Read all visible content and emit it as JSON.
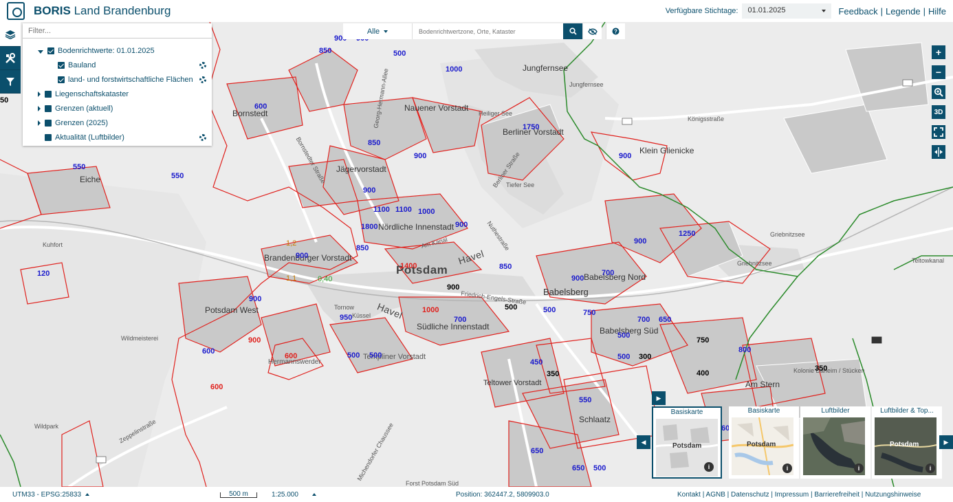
{
  "header": {
    "app_title_bold": "BORIS",
    "app_title_rest": "Land Brandenburg",
    "stichtag_label": "Verfügbare Stichtage:",
    "stichtag_value": "01.01.2025",
    "links": [
      "Feedback",
      "Legende",
      "Hilfe"
    ]
  },
  "layers": {
    "filter_placeholder": "Filter...",
    "items": [
      {
        "label": "Bodenrichtwerte: 01.01.2025"
      },
      {
        "label": "Bauland"
      },
      {
        "label": "land- und forstwirtschaftliche Flächen"
      },
      {
        "label": "Liegenschaftskataster"
      },
      {
        "label": "Grenzen (aktuell)"
      },
      {
        "label": "Grenzen (2025)"
      },
      {
        "label": "Aktualität (Luftbilder)"
      }
    ]
  },
  "search": {
    "filter_value": "Alle",
    "placeholder": "Bodenrichtwertzone, Orte, Kataster"
  },
  "map_controls": {
    "zoom_in": "+",
    "zoom_out": "−",
    "three_d": "3D"
  },
  "map_labels": [
    {
      "text": "Bornstedt"
    },
    {
      "text": "Eiche"
    },
    {
      "text": "Nauener Vorstadt"
    },
    {
      "text": "Jägervorstadt"
    },
    {
      "text": "Berliner Vorstadt"
    },
    {
      "text": "Jungfernsee"
    },
    {
      "text": "Jungfernsee"
    },
    {
      "text": "Klein Glienicke"
    },
    {
      "text": "Tiefer See"
    },
    {
      "text": "Heiliger See"
    },
    {
      "text": "Königsstraße"
    },
    {
      "text": "Griebnitzsee"
    },
    {
      "text": "Griebnitzsee"
    },
    {
      "text": "Brandenburger Vorstadt"
    },
    {
      "text": "Nördliche Innenstadt"
    },
    {
      "text": "Potsdam"
    },
    {
      "text": "Havel"
    },
    {
      "text": "Havel"
    },
    {
      "text": "Babelsberg Nord"
    },
    {
      "text": "Babelsberg"
    },
    {
      "text": "Babelsberg Süd"
    },
    {
      "text": "Potsdam West"
    },
    {
      "text": "Südliche Innenstadt"
    },
    {
      "text": "Templiner Vorstadt"
    },
    {
      "text": "Hermannswerder"
    },
    {
      "text": "Teltower Vorstadt"
    },
    {
      "text": "Schlaatz"
    },
    {
      "text": "Am Stern"
    },
    {
      "text": "Wildmeisterei"
    },
    {
      "text": "Wildpark"
    },
    {
      "text": "Kuhfort"
    },
    {
      "text": "Zeppelinstraße"
    },
    {
      "text": "Bornstedter Straße"
    },
    {
      "text": "Georg-Hermann-Allee"
    },
    {
      "text": "Berliner Straße"
    },
    {
      "text": "Nuthestraße"
    },
    {
      "text": "Friedrich-Engels-Straße"
    },
    {
      "text": "Am Kanal"
    },
    {
      "text": "Teltowkanal"
    },
    {
      "text": "Kolonie Daheim / Stücken"
    },
    {
      "text": "Tornow"
    },
    {
      "text": "Küssel"
    },
    {
      "text": "Michendorfer Chaussee"
    },
    {
      "text": "Forst Potsdam Süd"
    }
  ],
  "values": [
    {
      "text": "900",
      "color": "blue"
    },
    {
      "text": "900",
      "color": "blue"
    },
    {
      "text": "850",
      "color": "blue"
    },
    {
      "text": "500",
      "color": "blue"
    },
    {
      "text": "1000",
      "color": "blue"
    },
    {
      "text": "600",
      "color": "blue"
    },
    {
      "text": "850",
      "color": "blue"
    },
    {
      "text": "900",
      "color": "blue"
    },
    {
      "text": "1750",
      "color": "blue"
    },
    {
      "text": "900",
      "color": "blue"
    },
    {
      "text": "550",
      "color": "blue"
    },
    {
      "text": "550",
      "color": "blue"
    },
    {
      "text": "900",
      "color": "blue"
    },
    {
      "text": "1100",
      "color": "blue"
    },
    {
      "text": "1100",
      "color": "blue"
    },
    {
      "text": "1000",
      "color": "blue"
    },
    {
      "text": "1800",
      "color": "blue"
    },
    {
      "text": "900",
      "color": "blue"
    },
    {
      "text": "1250",
      "color": "blue"
    },
    {
      "text": "900",
      "color": "blue"
    },
    {
      "text": "850",
      "color": "blue"
    },
    {
      "text": "900",
      "color": "blue"
    },
    {
      "text": "1,2",
      "color": "orange"
    },
    {
      "text": "120",
      "color": "blue"
    },
    {
      "text": "1400",
      "color": "red"
    },
    {
      "text": "850",
      "color": "blue"
    },
    {
      "text": "900",
      "color": "blue"
    },
    {
      "text": "700",
      "color": "blue"
    },
    {
      "text": "1,1",
      "color": "orange"
    },
    {
      "text": "0,40",
      "color": "green"
    },
    {
      "text": "900",
      "color": "black"
    },
    {
      "text": "900",
      "color": "blue"
    },
    {
      "text": "500",
      "color": "black"
    },
    {
      "text": "500",
      "color": "blue"
    },
    {
      "text": "750",
      "color": "blue"
    },
    {
      "text": "1000",
      "color": "red"
    },
    {
      "text": "950",
      "color": "blue"
    },
    {
      "text": "700",
      "color": "blue"
    },
    {
      "text": "700",
      "color": "blue"
    },
    {
      "text": "650",
      "color": "blue"
    },
    {
      "text": "900",
      "color": "red"
    },
    {
      "text": "500",
      "color": "blue"
    },
    {
      "text": "750",
      "color": "black"
    },
    {
      "text": "600",
      "color": "blue"
    },
    {
      "text": "600",
      "color": "red"
    },
    {
      "text": "500",
      "color": "blue"
    },
    {
      "text": "500",
      "color": "blue"
    },
    {
      "text": "500",
      "color": "blue"
    },
    {
      "text": "300",
      "color": "black"
    },
    {
      "text": "800",
      "color": "blue"
    },
    {
      "text": "450",
      "color": "blue"
    },
    {
      "text": "350",
      "color": "black"
    },
    {
      "text": "400",
      "color": "black"
    },
    {
      "text": "350",
      "color": "black"
    },
    {
      "text": "600",
      "color": "red"
    },
    {
      "text": "550",
      "color": "blue"
    },
    {
      "text": "650",
      "color": "blue"
    },
    {
      "text": "650",
      "color": "blue"
    },
    {
      "text": "500",
      "color": "blue"
    },
    {
      "text": "60",
      "color": "blue"
    },
    {
      "text": "50",
      "color": "black"
    }
  ],
  "basemaps": [
    {
      "label": "Basiskarte",
      "active": true
    },
    {
      "label": "Basiskarte",
      "active": false
    },
    {
      "label": "Luftbilder",
      "active": false
    },
    {
      "label": "Luftbilder & Top...",
      "active": false
    }
  ],
  "basemap_thumb_label": "Potsdam",
  "footer": {
    "crs": "UTM33 - EPSG:25833",
    "scale_bar": "500 m",
    "scale": "1:25.000",
    "position": "Position: 362447.2, 5809903.0",
    "links": [
      "Kontakt",
      "AGNB",
      "Datenschutz",
      "Impressum",
      "Barrierefreiheit",
      "Nutzungshinweise"
    ]
  },
  "colors": {
    "primary": "#0b4f6c",
    "zone_border": "#e0201c",
    "value_blue": "#1a1acc",
    "boundary_green": "#2a8a2a"
  }
}
